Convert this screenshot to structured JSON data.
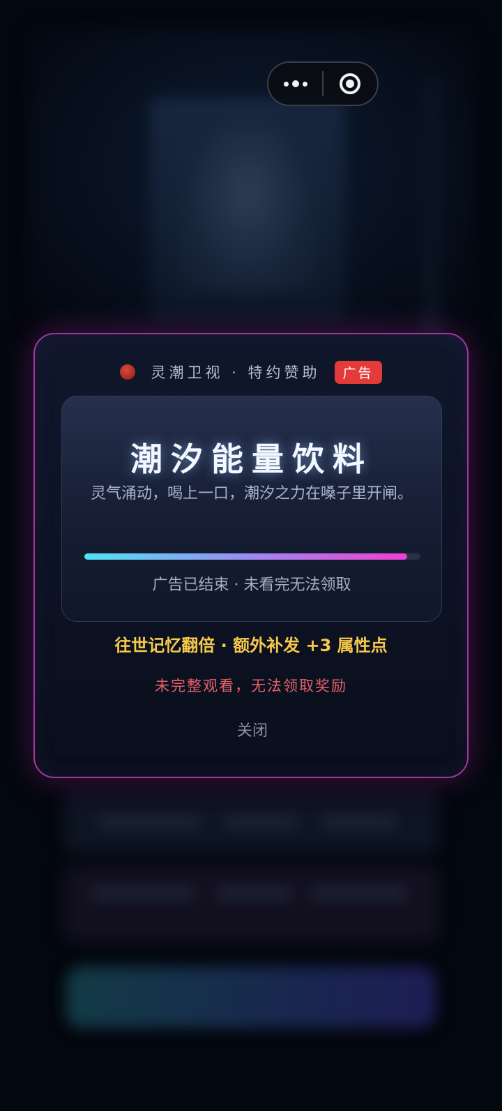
{
  "capsule": {
    "more_icon": "more-dots-icon",
    "close_icon": "target-close-icon"
  },
  "modal": {
    "sponsor": {
      "brand_icon": "red-dot-logo",
      "text": "灵潮卫视 · 特约赞助",
      "ad_badge": "广告"
    },
    "ad": {
      "title": "潮汐能量饮料",
      "slogan": "灵气涌动，喝上一口，潮汐之力在嗓子里开闸。",
      "progress": 0.96,
      "status": "广告已结束 · 未看完无法领取"
    },
    "reward": "往世记忆翻倍 · 额外补发 +3 属性点",
    "error": "未完整观看，无法领取奖励",
    "close_label": "关闭"
  },
  "colors": {
    "modal_border": "#9d3a9a",
    "ad_badge": "#e43a3a",
    "reward": "#f7c94a",
    "error": "#e8616a",
    "progress_start": "#50e3f5",
    "progress_end": "#f03fd3"
  }
}
